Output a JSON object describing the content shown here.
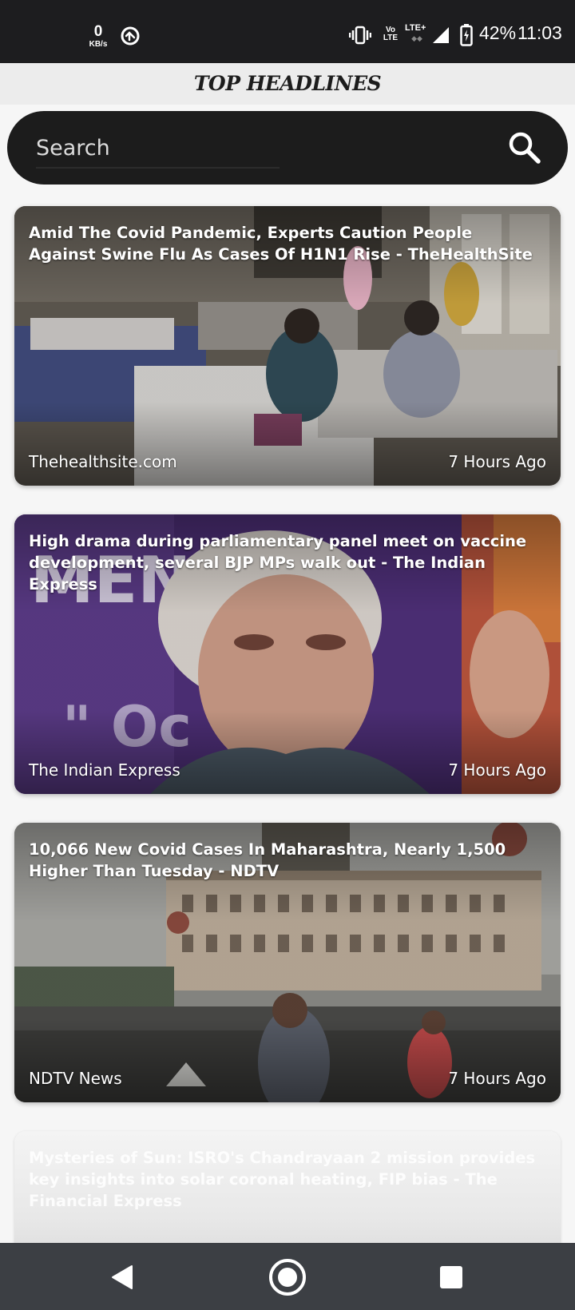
{
  "status_bar": {
    "net_speed": "0",
    "net_unit": "KB/s",
    "volte_top": "Vo",
    "volte_bottom": "LTE",
    "lte_label": "LTE+",
    "battery": "42%",
    "time": "11:03"
  },
  "header": {
    "title": "TOP HEADLINES"
  },
  "search": {
    "placeholder": "Search",
    "value": ""
  },
  "news": [
    {
      "title": "Amid The Covid Pandemic, Experts Caution People Against Swine Flu As Cases Of H1N1 Rise - TheHealthSite",
      "source": "Thehealthsite.com",
      "time": "7 Hours Ago"
    },
    {
      "title": "High drama during parliamentary panel meet on vaccine development, several BJP MPs walk out - The Indian Express",
      "source": "The Indian Express",
      "time": "7 Hours Ago"
    },
    {
      "title": "10,066 New Covid Cases In Maharashtra, Nearly 1,500 Higher Than Tuesday - NDTV",
      "source": "NDTV News",
      "time": "7 Hours Ago"
    },
    {
      "title": "Mysteries of Sun: ISRO's Chandrayaan 2 mission provides key insights into solar coronal heating, FIP bias - The Financial Express"
    }
  ],
  "nav_icons": [
    "back-icon",
    "home-icon",
    "recents-icon"
  ],
  "colors": {
    "status_bar": "#1d1d1f",
    "header_bg": "#ececec",
    "search_bg": "#1c1c1c",
    "nav_bar": "#3c3f44",
    "page_bg": "#f6f6f6"
  }
}
